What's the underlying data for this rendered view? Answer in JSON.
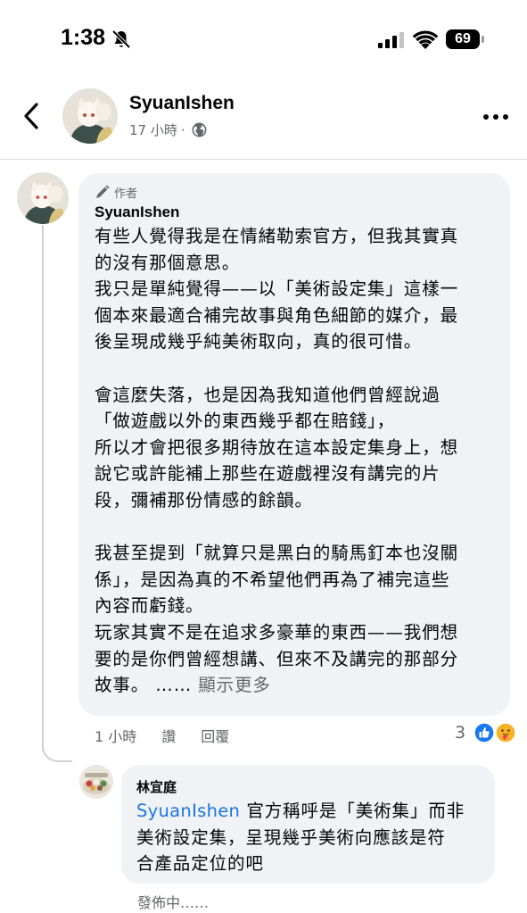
{
  "status_bar": {
    "time": "1:38",
    "battery": "69",
    "icons": [
      "bell-muted-icon",
      "signal-icon",
      "wifi-icon",
      "battery-icon"
    ]
  },
  "header": {
    "name": "SyuanIshen",
    "time_ago": "17 小時",
    "separator": "·",
    "icons": [
      "back-arrow-icon",
      "globe-icon",
      "more-dots-icon"
    ]
  },
  "comment": {
    "badge": "作者",
    "author": "SyuanIshen",
    "lines": [
      "有些人覺得我是在情緒勒索官方，但我其實真",
      "的沒有那個意思。",
      "我只是單純覺得——以「美術設定集」這樣一",
      "個本來最適合補完故事與角色細節的媒介，最",
      "後呈現成幾乎純美術取向，真的很可惜。",
      "",
      "會這麼失落，也是因為我知道他們曾經說過",
      "「做遊戲以外的東西幾乎都在賠錢」，",
      "所以才會把很多期待放在這本設定集身上，想",
      "說它或許能補上那些在遊戲裡沒有講完的片",
      "段，彌補那份情感的餘韻。",
      "",
      "我甚至提到「就算只是黑白的騎馬釘本也沒關",
      "係」，是因為真的不希望他們再為了補完這些",
      "內容而虧錢。",
      "玩家其實不是在追求多豪華的東西——我們想",
      "要的是你們曾經想講、但來不及講完的那部分"
    ],
    "last_line": "故事。 ……",
    "see_more": "顯示更多",
    "time_ago": "1 小時",
    "read_label": "讚",
    "reply_label": "回覆",
    "reaction_count": "3",
    "reactions": [
      "like-icon",
      "care-icon"
    ]
  },
  "reply": {
    "author": "林宜庭",
    "mention": "SyuanIshen",
    "line1_rest": " 官方稱呼是「美術集」而非",
    "line2": "美術設定集，呈現幾乎美術向應該是符",
    "line3": "合產品定位的吧",
    "status": "發佈中……"
  },
  "colors": {
    "bubble": "#f0f2f5",
    "secondary_text": "#65676b",
    "mention": "#1b74e4",
    "like": "#1877f2"
  }
}
